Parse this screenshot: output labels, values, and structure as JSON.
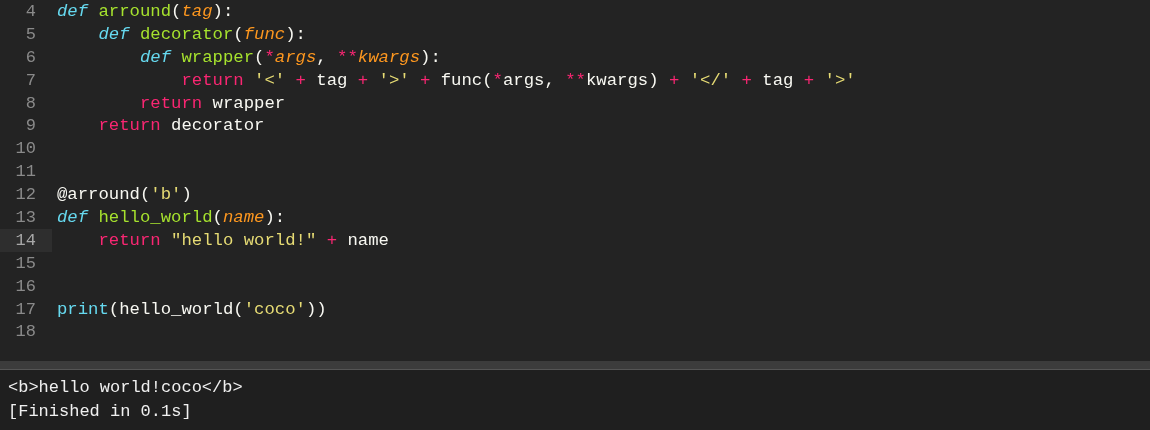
{
  "editor": {
    "lines": [
      {
        "number": "4",
        "current": false,
        "tokens": [
          {
            "text": "def",
            "kind": "keyword"
          },
          {
            "text": " arround",
            "kind": "function"
          },
          {
            "text": "(",
            "kind": "plain"
          },
          {
            "text": "tag",
            "kind": "parameter"
          },
          {
            "text": "):",
            "kind": "plain"
          }
        ]
      },
      {
        "number": "5",
        "current": false,
        "tokens": [
          {
            "text": "    def",
            "kind": "keyword"
          },
          {
            "text": " decorator",
            "kind": "function"
          },
          {
            "text": "(",
            "kind": "plain"
          },
          {
            "text": "func",
            "kind": "parameter"
          },
          {
            "text": "):",
            "kind": "plain"
          }
        ]
      },
      {
        "number": "6",
        "current": false,
        "tokens": [
          {
            "text": "        def",
            "kind": "keyword"
          },
          {
            "text": " wrapper",
            "kind": "function"
          },
          {
            "text": "(",
            "kind": "plain"
          },
          {
            "text": "*",
            "kind": "operator"
          },
          {
            "text": "args",
            "kind": "parameter"
          },
          {
            "text": ", ",
            "kind": "plain"
          },
          {
            "text": "**",
            "kind": "operator"
          },
          {
            "text": "kwargs",
            "kind": "parameter"
          },
          {
            "text": "):",
            "kind": "plain"
          }
        ]
      },
      {
        "number": "7",
        "current": false,
        "tokens": [
          {
            "text": "            return",
            "kind": "control"
          },
          {
            "text": " '<'",
            "kind": "string"
          },
          {
            "text": " +",
            "kind": "operator"
          },
          {
            "text": " tag",
            "kind": "plain"
          },
          {
            "text": " +",
            "kind": "operator"
          },
          {
            "text": " '>'",
            "kind": "string"
          },
          {
            "text": " +",
            "kind": "operator"
          },
          {
            "text": " func(",
            "kind": "plain"
          },
          {
            "text": "*",
            "kind": "operator"
          },
          {
            "text": "args, ",
            "kind": "plain"
          },
          {
            "text": "**",
            "kind": "operator"
          },
          {
            "text": "kwargs)",
            "kind": "plain"
          },
          {
            "text": " +",
            "kind": "operator"
          },
          {
            "text": " '</'",
            "kind": "string"
          },
          {
            "text": " +",
            "kind": "operator"
          },
          {
            "text": " tag",
            "kind": "plain"
          },
          {
            "text": " +",
            "kind": "operator"
          },
          {
            "text": " '>'",
            "kind": "string"
          }
        ]
      },
      {
        "number": "8",
        "current": false,
        "tokens": [
          {
            "text": "        return",
            "kind": "control"
          },
          {
            "text": " wrapper",
            "kind": "plain"
          }
        ]
      },
      {
        "number": "9",
        "current": false,
        "tokens": [
          {
            "text": "    return",
            "kind": "control"
          },
          {
            "text": " decorator",
            "kind": "plain"
          }
        ]
      },
      {
        "number": "10",
        "current": false
      },
      {
        "number": "11",
        "current": false
      },
      {
        "number": "12",
        "current": false,
        "tokens": [
          {
            "text": "@arround(",
            "kind": "plain"
          },
          {
            "text": "'b'",
            "kind": "string"
          },
          {
            "text": ")",
            "kind": "plain"
          }
        ]
      },
      {
        "number": "13",
        "current": false,
        "tokens": [
          {
            "text": "def",
            "kind": "keyword"
          },
          {
            "text": " hello_world",
            "kind": "function"
          },
          {
            "text": "(",
            "kind": "plain"
          },
          {
            "text": "name",
            "kind": "parameter"
          },
          {
            "text": "):",
            "kind": "plain"
          }
        ]
      },
      {
        "number": "14",
        "current": true,
        "tokens": [
          {
            "text": "    return",
            "kind": "control"
          },
          {
            "text": " \"hello world!\"",
            "kind": "string"
          },
          {
            "text": " +",
            "kind": "operator"
          },
          {
            "text": " name",
            "kind": "plain"
          }
        ]
      },
      {
        "number": "15",
        "current": false
      },
      {
        "number": "16",
        "current": false
      },
      {
        "number": "17",
        "current": false,
        "tokens": [
          {
            "text": "print",
            "kind": "builtin"
          },
          {
            "text": "(hello_world(",
            "kind": "plain"
          },
          {
            "text": "'coco'",
            "kind": "string"
          },
          {
            "text": "))",
            "kind": "plain"
          }
        ]
      },
      {
        "number": "18",
        "current": false
      }
    ]
  },
  "output": {
    "lines": [
      "<b>hello world!coco</b>",
      "[Finished in 0.1s]"
    ]
  }
}
